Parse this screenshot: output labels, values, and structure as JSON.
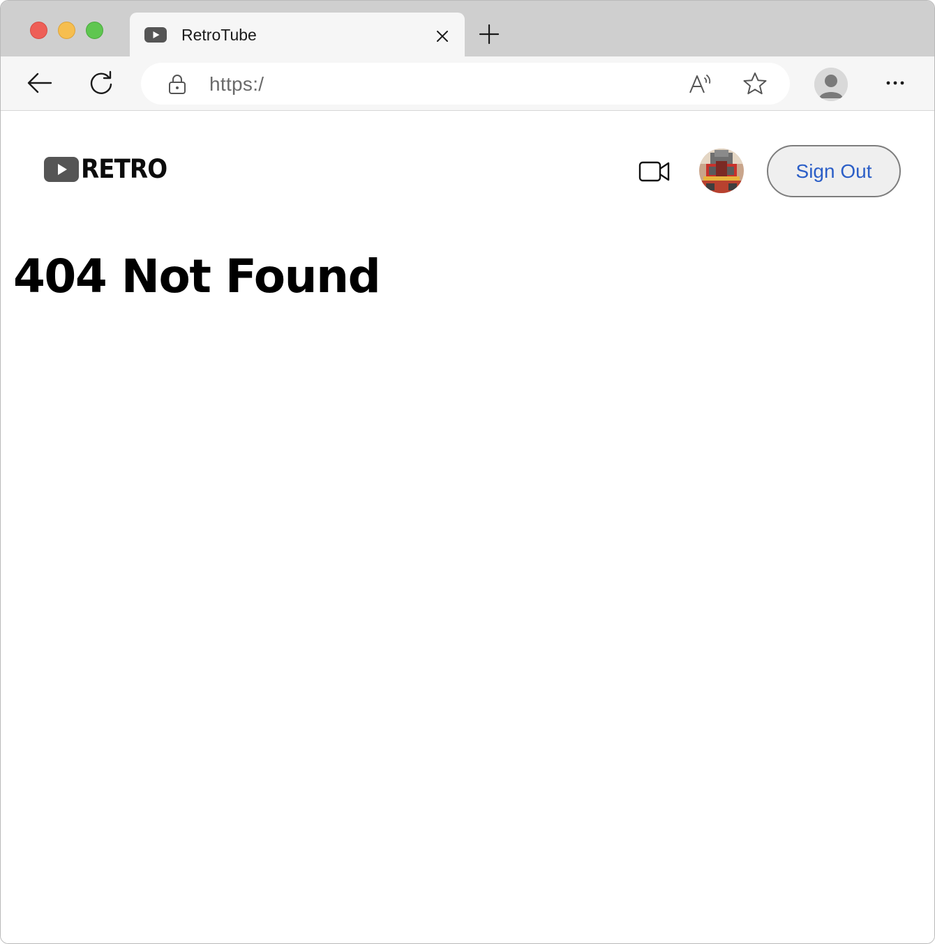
{
  "browser": {
    "tab": {
      "title": "RetroTube",
      "favicon": "video-play-icon"
    },
    "address_bar": {
      "url": "https:/"
    },
    "icons": {
      "back": "back-arrow-icon",
      "reload": "reload-icon",
      "lock": "lock-icon",
      "read_aloud": "read-aloud-icon",
      "favorite": "star-icon",
      "profile": "profile-avatar-icon",
      "more": "more-dots-icon",
      "close_tab": "close-icon",
      "new_tab": "plus-icon"
    },
    "colors": {
      "traffic_red": "#ee5f57",
      "traffic_yellow": "#f6be4f",
      "traffic_green": "#5fc650",
      "tabstrip_bg": "#cfcfcf",
      "toolbar_bg": "#f6f6f6"
    }
  },
  "site": {
    "logo_text": "RETRO",
    "upload_icon": "video-camera-icon",
    "avatar": "user-avatar-image",
    "sign_out_label": "Sign Out",
    "colors": {
      "sign_out_text": "#2b5ec7",
      "sign_out_bg": "#efefef",
      "logo_icon": "#555555"
    }
  },
  "main": {
    "heading": "404 Not Found"
  }
}
